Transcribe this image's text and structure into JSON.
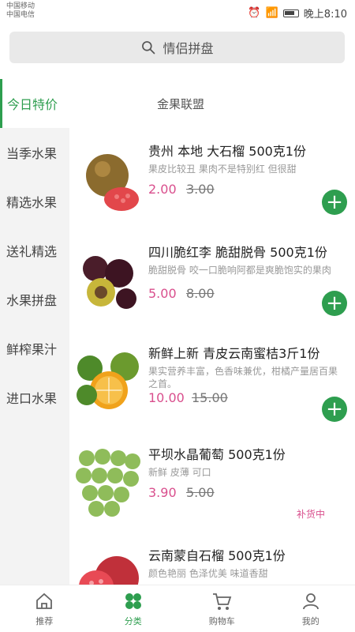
{
  "status": {
    "carrier1": "中国移动",
    "carrier2": "中国电信",
    "time": "晚上8:10"
  },
  "search": {
    "placeholder": "情侣拼盘"
  },
  "tabs": [
    "今日特价",
    "金果联盟"
  ],
  "categories": [
    "今日特价",
    "当季水果",
    "精选水果",
    "送礼精选",
    "水果拼盘",
    "鲜榨果汁",
    "进口水果"
  ],
  "products": [
    {
      "title": "贵州 本地 大石榴 500克1份",
      "desc": "果皮比较丑  果肉不是特别红  但很甜",
      "price": "2.00",
      "old_price": "3.00",
      "status": "add"
    },
    {
      "title": "四川脆红李 脆甜脱骨 500克1份",
      "desc": "脆甜脱骨 咬一口脆响阿都是爽脆饱实的果肉",
      "price": "5.00",
      "old_price": "8.00",
      "status": "add"
    },
    {
      "title": "新鲜上新 青皮云南蜜桔3斤1份",
      "desc": "果实营养丰富，色香味兼优，柑橘产量居百果之首。",
      "price": "10.00",
      "old_price": "15.00",
      "status": "add"
    },
    {
      "title": "平坝水晶葡萄 500克1份",
      "desc": "新鲜 皮薄 可口",
      "price": "3.90",
      "old_price": "5.00",
      "status": "补货中"
    },
    {
      "title": "云南蒙自石榴 500克1份",
      "desc": "颜色艳丽  色泽优美 味道香甜",
      "price": "",
      "old_price": "",
      "status": ""
    }
  ],
  "bottom_nav": [
    {
      "label": "推荐",
      "icon": "home-icon"
    },
    {
      "label": "分类",
      "icon": "category-icon"
    },
    {
      "label": "购物车",
      "icon": "cart-icon"
    },
    {
      "label": "我的",
      "icon": "profile-icon"
    }
  ],
  "colors": {
    "accent": "#2e9e4f",
    "price": "#d94f8d"
  }
}
